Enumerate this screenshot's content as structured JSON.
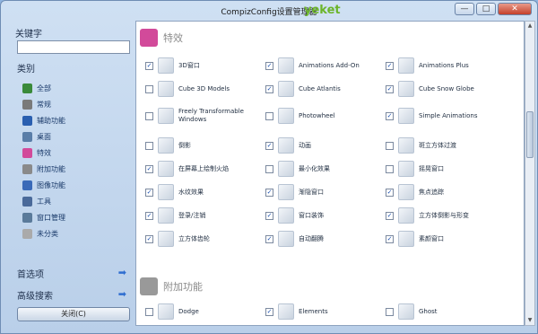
{
  "window": {
    "title": "CompizConfig设置管理器",
    "logo": "yeket",
    "buttons": {
      "minimize": "—",
      "maximize": "□",
      "close": "✕"
    }
  },
  "sidebar": {
    "keyword_label": "关键字",
    "keyword_value": "",
    "category_label": "类别",
    "categories": [
      {
        "label": "全部",
        "icon": "globe-icon",
        "color": "#3a8a3a"
      },
      {
        "label": "常规",
        "icon": "gear-icon",
        "color": "#7a7a7a"
      },
      {
        "label": "辅助功能",
        "icon": "accessibility-icon",
        "color": "#2a5fb0"
      },
      {
        "label": "桌面",
        "icon": "desktop-icon",
        "color": "#5a7ea8"
      },
      {
        "label": "特效",
        "icon": "effects-icon",
        "color": "#d24a9a"
      },
      {
        "label": "附加功能",
        "icon": "extras-icon",
        "color": "#8a8a8a"
      },
      {
        "label": "图像功能",
        "icon": "image-icon",
        "color": "#3a6ab8"
      },
      {
        "label": "工具",
        "icon": "tools-icon",
        "color": "#4a6a9a"
      },
      {
        "label": "窗口管理",
        "icon": "window-management-icon",
        "color": "#5a7a9a"
      },
      {
        "label": "未分类",
        "icon": "question-icon",
        "color": "#aaaaaa"
      }
    ],
    "preferences_label": "首选项",
    "advanced_search_label": "高级搜索",
    "close_button_label": "关闭(C)"
  },
  "main": {
    "sections": [
      {
        "title": "特效",
        "icon": "effects-section-icon",
        "rows": [
          [
            {
              "label": "3D窗口",
              "checked": true,
              "icon": "3d-windows-icon"
            },
            {
              "label": "Animations Add-On",
              "checked": true,
              "icon": "animations-addon-icon"
            },
            {
              "label": "Animations Plus",
              "checked": true,
              "icon": "animations-plus-icon"
            }
          ],
          [
            {
              "label": "Cube 3D Models",
              "checked": false,
              "icon": "cube-3d-models-icon"
            },
            {
              "label": "Cube Atlantis",
              "checked": true,
              "icon": "cube-atlantis-icon"
            },
            {
              "label": "Cube Snow Globe",
              "checked": true,
              "icon": "cube-snow-globe-icon"
            }
          ],
          [
            {
              "label": "Freely Transformable Windows",
              "checked": false,
              "icon": "freely-transformable-icon"
            },
            {
              "label": "Photowheel",
              "checked": false,
              "icon": "photowheel-icon"
            },
            {
              "label": "Simple Animations",
              "checked": true,
              "icon": "simple-animations-icon"
            }
          ],
          [
            {
              "label": "倒影",
              "checked": false,
              "icon": "reflection-icon"
            },
            {
              "label": "动画",
              "checked": true,
              "icon": "animation-icon"
            },
            {
              "label": "斑立方体过渡",
              "checked": false,
              "icon": "cube-transition-icon"
            }
          ],
          [
            {
              "label": "在屏幕上绘制火焰",
              "checked": true,
              "icon": "fire-icon"
            },
            {
              "label": "最小化效果",
              "checked": false,
              "icon": "minimize-effect-icon"
            },
            {
              "label": "摇晃窗口",
              "checked": false,
              "icon": "wobbly-icon"
            }
          ],
          [
            {
              "label": "水纹效果",
              "checked": true,
              "icon": "water-icon"
            },
            {
              "label": "渐隐窗口",
              "checked": true,
              "icon": "fade-icon"
            },
            {
              "label": "焦点追踪",
              "checked": true,
              "icon": "focus-icon"
            }
          ],
          [
            {
              "label": "登录/注销",
              "checked": true,
              "icon": "login-icon"
            },
            {
              "label": "窗口装饰",
              "checked": true,
              "icon": "decoration-icon"
            },
            {
              "label": "立方体倒影与形变",
              "checked": true,
              "icon": "cube-reflection-icon"
            }
          ],
          [
            {
              "label": "立方体齿轮",
              "checked": true,
              "icon": "cube-gears-icon"
            },
            {
              "label": "自动翻腾",
              "checked": true,
              "icon": "auto-roll-icon"
            },
            {
              "label": "素颜窗口",
              "checked": true,
              "icon": "plain-window-icon"
            }
          ]
        ]
      },
      {
        "title": "附加功能",
        "icon": "extras-section-icon",
        "rows": [
          [
            {
              "label": "Dodge",
              "checked": false,
              "icon": "dodge-icon"
            },
            {
              "label": "Elements",
              "checked": true,
              "icon": "elements-icon"
            },
            {
              "label": "Ghost",
              "checked": false,
              "icon": "ghost-icon"
            }
          ]
        ]
      }
    ]
  }
}
